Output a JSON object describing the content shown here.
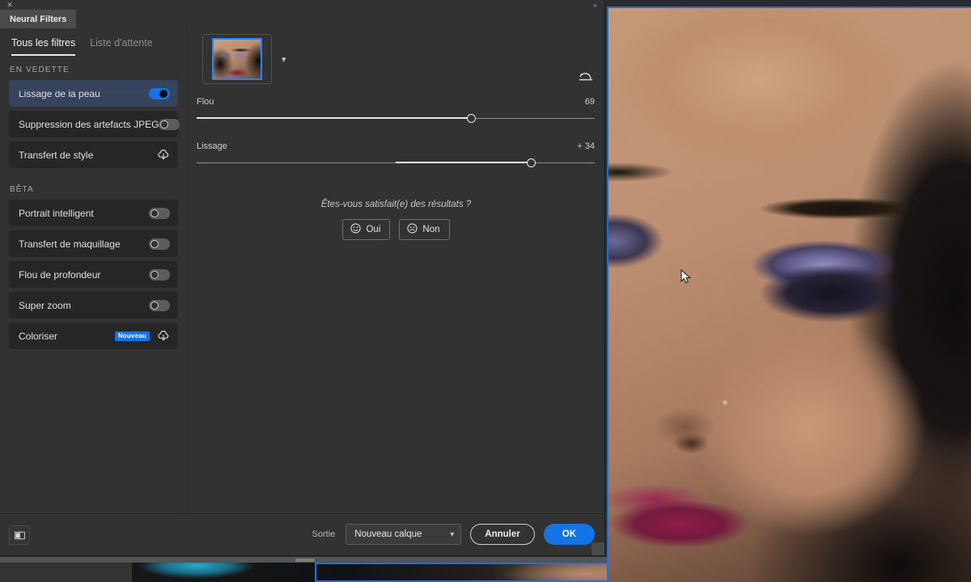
{
  "window": {
    "panel_tab_label": "Neural Filters",
    "close_icon": "close-icon",
    "collapse_icon": "collapse-panel-icon"
  },
  "sidebar": {
    "tabs": [
      {
        "label": "Tous les filtres",
        "active": true
      },
      {
        "label": "Liste d'attente",
        "active": false
      }
    ],
    "groups": [
      {
        "label": "EN VEDETTE",
        "items": [
          {
            "label": "Lissage de la peau",
            "control": "toggle",
            "state": "on",
            "selected": true
          },
          {
            "label": "Suppression des artefacts JPEG",
            "control": "toggle",
            "state": "off",
            "selected": false
          },
          {
            "label": "Transfert de style",
            "control": "download",
            "state": "off",
            "selected": false
          }
        ]
      },
      {
        "label": "BÊTA",
        "items": [
          {
            "label": "Portrait intelligent",
            "control": "toggle",
            "state": "off",
            "selected": false
          },
          {
            "label": "Transfert de maquillage",
            "control": "toggle",
            "state": "off",
            "selected": false
          },
          {
            "label": "Flou de profondeur",
            "control": "toggle",
            "state": "off",
            "selected": false
          },
          {
            "label": "Super zoom",
            "control": "toggle",
            "state": "off",
            "selected": false
          },
          {
            "label": "Coloriser",
            "control": "download",
            "state": "off",
            "selected": false,
            "badge": "Nouveau"
          }
        ]
      }
    ]
  },
  "main": {
    "thumbnail_caret_icon": "chevron-down-icon",
    "reset_icon": "reset-icon",
    "sliders": [
      {
        "name": "Flou",
        "value_label": "69",
        "value": 69,
        "min": 0,
        "max": 100,
        "origin": "start"
      },
      {
        "name": "Lissage",
        "value_label": "+ 34",
        "value": 34,
        "min": -50,
        "max": 50,
        "origin": "center"
      }
    ],
    "satisfaction": {
      "question": "Êtes-vous satisfait(e) des résultats ?",
      "yes_label": "Oui",
      "no_label": "Non",
      "yes_icon": "smiley-happy-icon",
      "no_icon": "smiley-sad-icon"
    }
  },
  "footer": {
    "panel_toggle_icon": "split-view-icon",
    "output_label": "Sortie",
    "output_value": "Nouveau calque",
    "output_caret_icon": "chevron-down-icon",
    "cancel_label": "Annuler",
    "ok_label": "OK"
  },
  "colors": {
    "accent": "#1473e6",
    "panel_bg": "#323232",
    "row_bg": "#262626",
    "row_selected_bg": "#35445c",
    "text": "#e0e0e0",
    "muted_text": "#8c8c8c",
    "selection_border": "#1473e6"
  }
}
